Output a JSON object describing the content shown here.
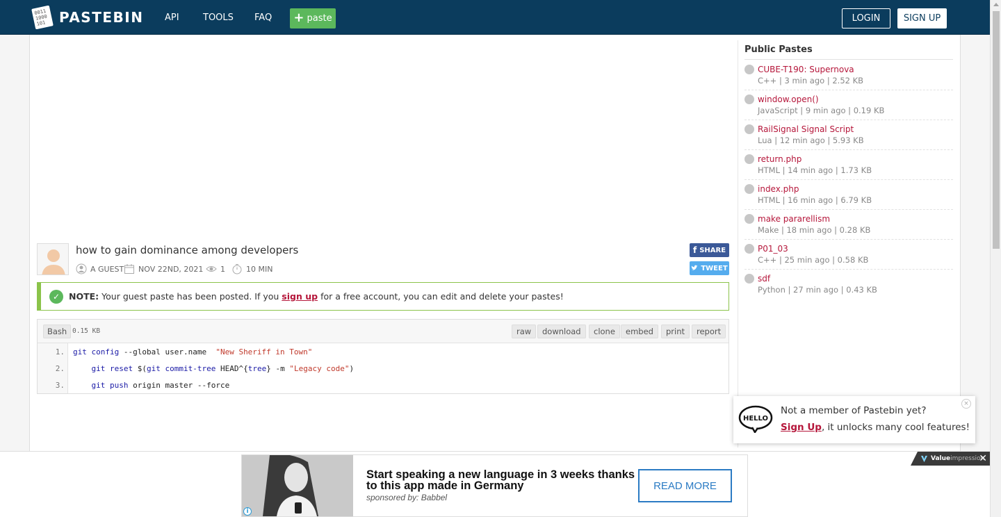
{
  "header": {
    "logo_text": "PASTEBIN",
    "nav": [
      "API",
      "TOOLS",
      "FAQ"
    ],
    "paste_label": "paste",
    "login_label": "LOGIN",
    "signup_label": "SIGN UP"
  },
  "paste": {
    "title": "how to gain dominance among developers",
    "author": "A GUEST",
    "date": "NOV 22ND, 2021",
    "views": "1",
    "expire": "10 MIN",
    "share_label": "SHARE",
    "tweet_label": "TWEET"
  },
  "note": {
    "bold": "NOTE:",
    "before_link": "Your guest paste has been posted. If you",
    "link": "sign up",
    "after_link": "for a free account, you can edit and delete your pastes!"
  },
  "code": {
    "language": "Bash",
    "size": "0.15 KB",
    "buttons": [
      "raw",
      "download",
      "clone",
      "embed",
      "print",
      "report"
    ],
    "line_numbers": [
      "1.",
      "2.",
      "3."
    ]
  },
  "sidebar": {
    "title": "Public Pastes",
    "items": [
      {
        "name": "CUBE-T190: Supernova",
        "meta": "C++ | 3 min ago | 2.52 KB"
      },
      {
        "name": "window.open()",
        "meta": "JavaScript | 9 min ago | 0.19 KB"
      },
      {
        "name": "RailSignal Signal Script",
        "meta": "Lua | 12 min ago | 5.93 KB"
      },
      {
        "name": "return.php",
        "meta": "HTML | 14 min ago | 1.73 KB"
      },
      {
        "name": "index.php",
        "meta": "HTML | 16 min ago | 6.79 KB"
      },
      {
        "name": "make pararellism",
        "meta": "Make | 18 min ago | 0.28 KB"
      },
      {
        "name": "P01_03",
        "meta": "C++ | 25 min ago | 0.58 KB"
      },
      {
        "name": "sdf",
        "meta": "Python | 27 min ago | 0.43 KB"
      }
    ]
  },
  "popup": {
    "line1": "Not a member of Pastebin yet?",
    "link": "Sign Up",
    "line2_rest": ", it unlocks many cool features!",
    "close": "×"
  },
  "bottom_ad": {
    "headline": "Start speaking a new language in 3 weeks thanks to this app made in Germany",
    "sponsor": "sponsored by: Babbel",
    "cta": "READ MORE",
    "vi_brand": "Value",
    "vi_brand_rest": "impression",
    "close": "✕"
  },
  "colors": {
    "header_bg": "#0b3c5d",
    "paste_btn": "#5cb85c",
    "link_red": "#b5163a",
    "note_border": "#8bc34a",
    "facebook": "#3b5998",
    "twitter": "#55acee"
  }
}
